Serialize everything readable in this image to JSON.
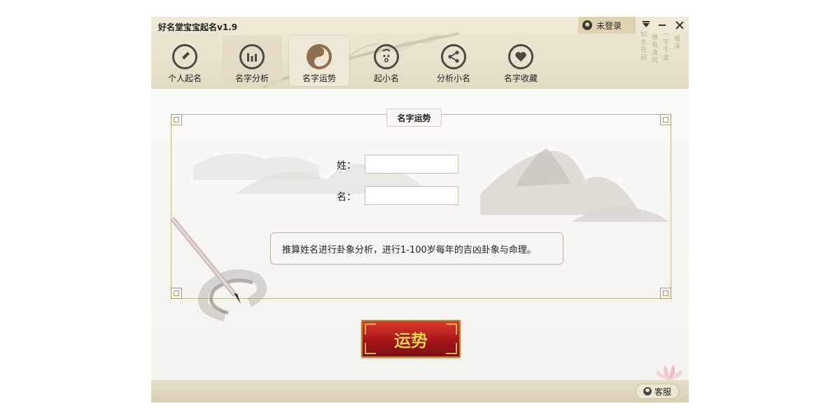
{
  "window": {
    "title": "好名堂宝宝起名v1.9",
    "login_label": "未登录",
    "icons": [
      "user-icon",
      "dropdown-icon",
      "minimize-icon",
      "close-icon"
    ]
  },
  "nav": {
    "items": [
      {
        "label": "个人起名",
        "icon": "pencil-icon"
      },
      {
        "label": "名字分析",
        "icon": "bar-chart-icon"
      },
      {
        "label": "名字运势",
        "icon": "yin-yang-icon",
        "active": true
      },
      {
        "label": "起小名",
        "icon": "baby-face-icon"
      },
      {
        "label": "分析小名",
        "icon": "share-icon"
      },
      {
        "label": "名字收藏",
        "icon": "heart-icon"
      }
    ]
  },
  "main": {
    "section_title": "名字运势",
    "surname_label": "姓：",
    "surname_value": "",
    "given_name_label": "名：",
    "given_name_value": "",
    "description": "推算姓名进行卦象分析，进行1-100岁每年的吉凶卦象与命理。",
    "submit_label": "运势"
  },
  "footer": {
    "service_label": "客服"
  },
  "colors": {
    "header_bg": "#e9e2cc",
    "button_red": "#a8161a",
    "button_text": "#f6d44a",
    "frame_border": "#c2b68e"
  }
}
